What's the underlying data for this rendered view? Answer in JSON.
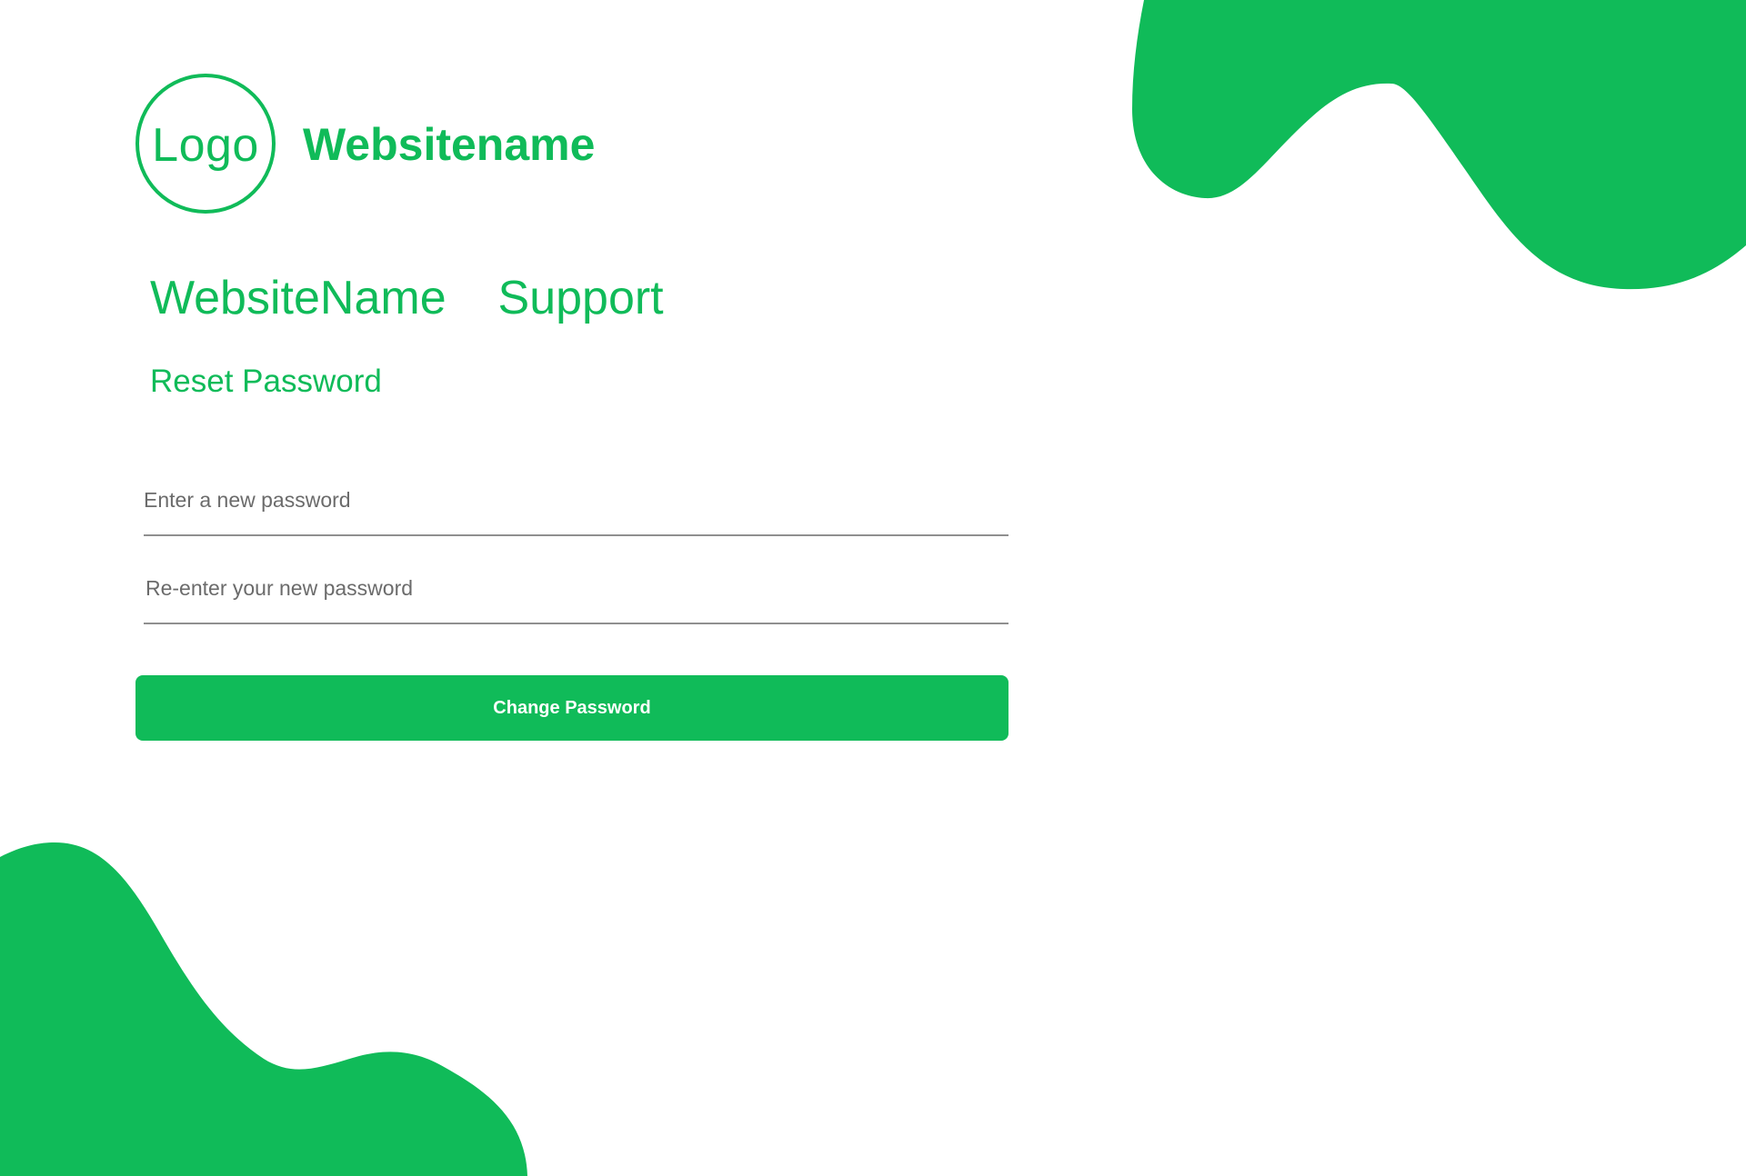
{
  "colors": {
    "brand_green": "#10bb59",
    "input_underline": "#8f8f8f",
    "placeholder_text": "#6b6b6b",
    "button_text": "#ffffff",
    "background": "#ffffff"
  },
  "header": {
    "logo_text": "Logo",
    "site_name": "Websitename"
  },
  "main": {
    "support_title": "WebsiteName  Support",
    "reset_title": "Reset Password"
  },
  "form": {
    "new_password_placeholder": "Enter a new password",
    "new_password_value": "",
    "confirm_password_placeholder": "Re-enter your new password",
    "confirm_password_value": "",
    "submit_label": "Change Password"
  }
}
